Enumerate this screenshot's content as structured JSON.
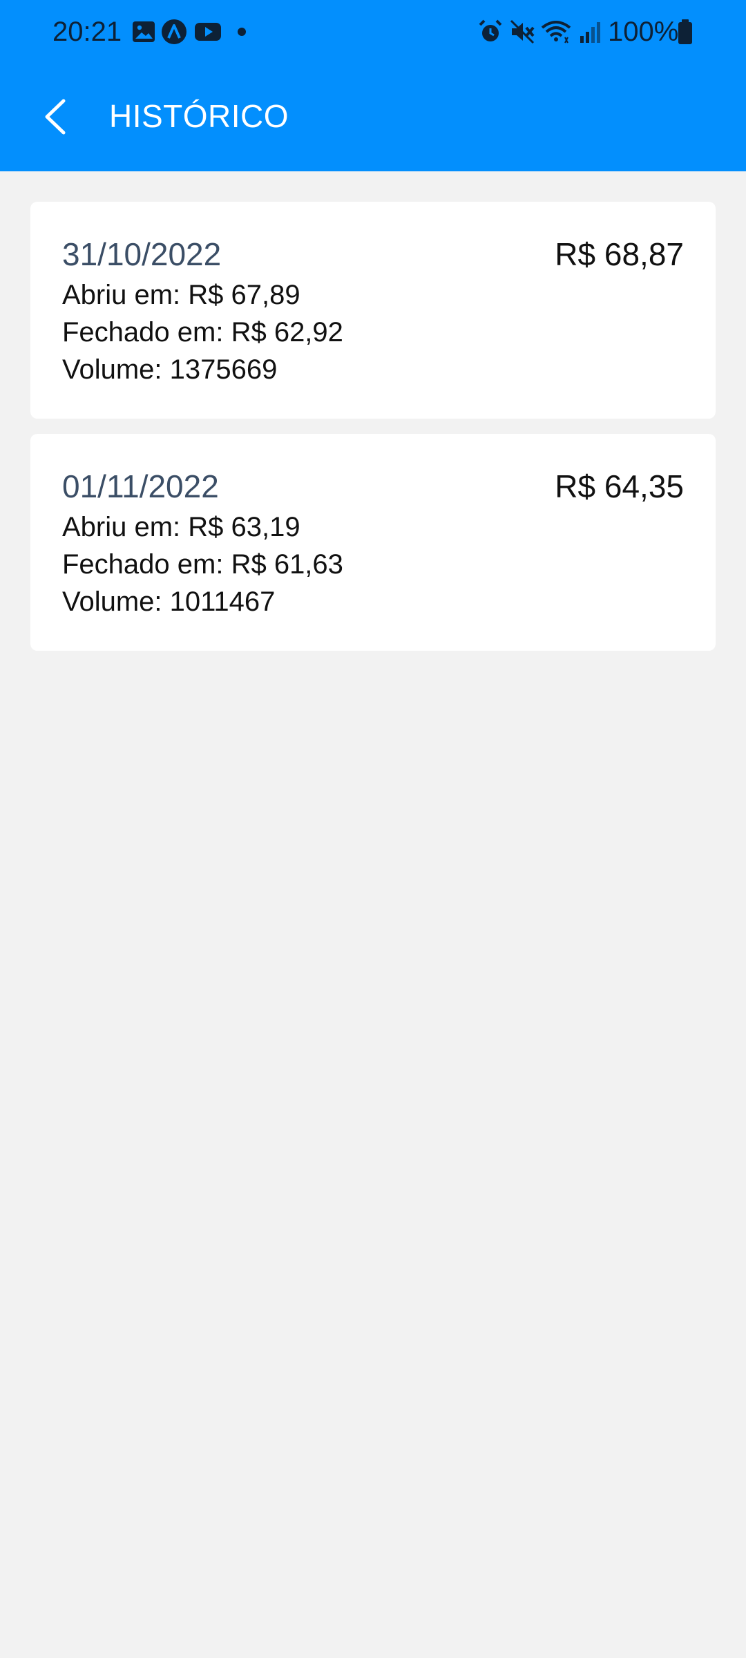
{
  "status_bar": {
    "time": "20:21",
    "battery_text": "100%",
    "icons": [
      "gallery-icon",
      "app-a-icon",
      "youtube-icon",
      "dot-icon",
      "alarm-icon",
      "mute-icon",
      "wifi-icon",
      "signal-icon",
      "battery-icon"
    ]
  },
  "header": {
    "title": "HISTÓRICO",
    "back_icon": "back-arrow-icon"
  },
  "colors": {
    "header_bg": "#038ffd",
    "page_bg": "#f2f2f2",
    "card_bg": "#ffffff",
    "date_text": "#3b4e66"
  },
  "history": [
    {
      "date": "31/10/2022",
      "price": "R$ 68,87",
      "opened": "Abriu em: R$ 67,89",
      "closed": "Fechado em: R$ 62,92",
      "volume": "Volume: 1375669"
    },
    {
      "date": "01/11/2022",
      "price": "R$ 64,35",
      "opened": "Abriu em: R$ 63,19",
      "closed": "Fechado em: R$ 61,63",
      "volume": "Volume: 1011467"
    }
  ]
}
